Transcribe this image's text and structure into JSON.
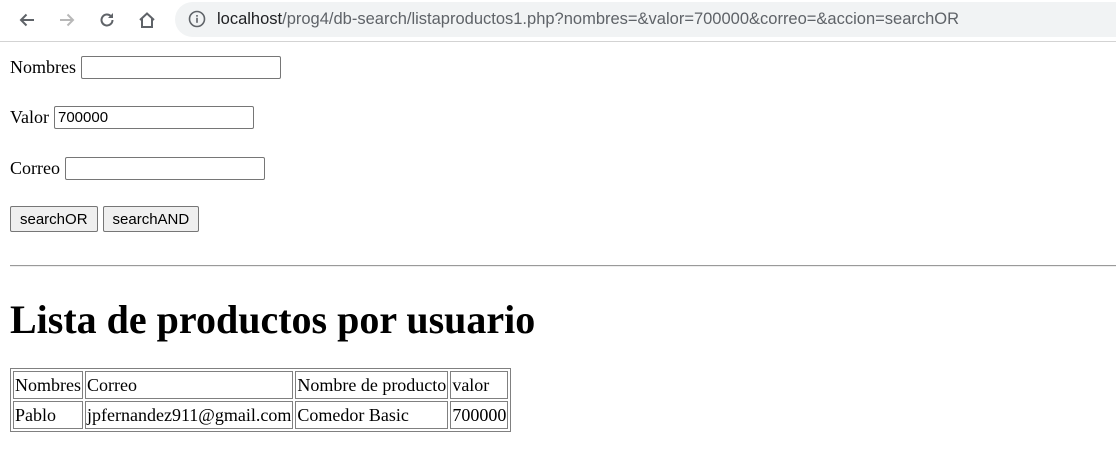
{
  "browser": {
    "url_host": "localhost",
    "url_path": "/prog4/db-search/listaproductos1.php?nombres=&valor=700000&correo=&accion=searchOR"
  },
  "form": {
    "nombres_label": "Nombres",
    "nombres_value": "",
    "valor_label": "Valor",
    "valor_value": "700000",
    "correo_label": "Correo",
    "correo_value": "",
    "search_or_label": "searchOR",
    "search_and_label": "searchAND"
  },
  "page_title": "Lista de productos por usuario",
  "table": {
    "headers": [
      "Nombres",
      "Correo",
      "Nombre de producto",
      "valor"
    ],
    "rows": [
      [
        "Pablo",
        "jpfernandez911@gmail.com",
        "Comedor Basic",
        "700000"
      ]
    ]
  }
}
